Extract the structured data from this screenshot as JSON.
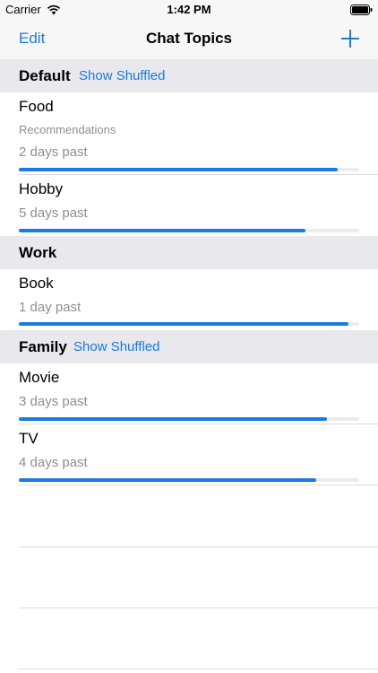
{
  "status_bar": {
    "carrier": "Carrier",
    "time": "1:42 PM"
  },
  "nav": {
    "edit_label": "Edit",
    "title": "Chat Topics",
    "add_icon": "plus-icon"
  },
  "accent_color": "#1a7ae6",
  "sections": {
    "default": {
      "title": "Default",
      "shuffle_label": "Show Shuffled",
      "rows": [
        {
          "title": "Food",
          "subtitle": "Recommendations",
          "days": "2 days past",
          "progress": 0.937
        },
        {
          "title": "Hobby",
          "days": "5 days past",
          "progress": 0.842
        }
      ]
    },
    "work": {
      "title": "Work",
      "rows": [
        {
          "title": "Book",
          "days": "1 day past",
          "progress": 0.968
        }
      ]
    },
    "family": {
      "title": "Family",
      "shuffle_label": "Show Shuffled",
      "rows": [
        {
          "title": "Movie",
          "days": "3 days past",
          "progress": 0.905
        },
        {
          "title": "TV",
          "days": "4 days past",
          "progress": 0.874
        }
      ]
    }
  }
}
